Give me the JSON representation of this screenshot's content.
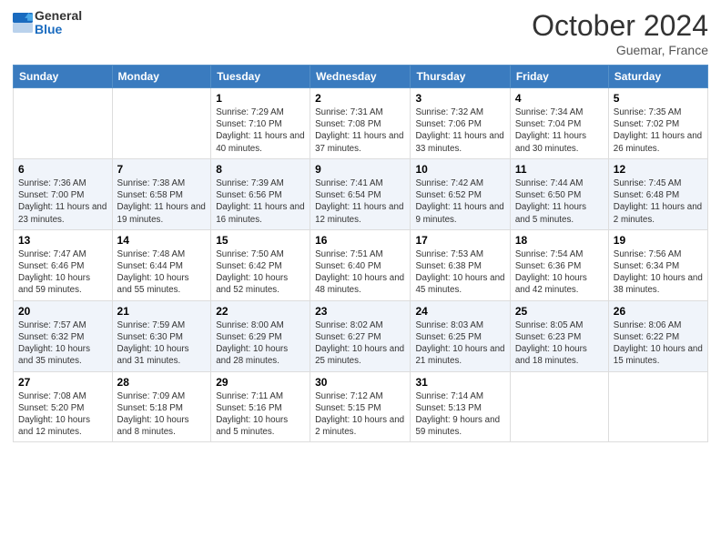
{
  "header": {
    "logo_general": "General",
    "logo_blue": "Blue",
    "month_title": "October 2024",
    "location": "Guemar, France"
  },
  "weekdays": [
    "Sunday",
    "Monday",
    "Tuesday",
    "Wednesday",
    "Thursday",
    "Friday",
    "Saturday"
  ],
  "weeks": [
    [
      {
        "day": "",
        "info": ""
      },
      {
        "day": "",
        "info": ""
      },
      {
        "day": "1",
        "info": "Sunrise: 7:29 AM\nSunset: 7:10 PM\nDaylight: 11 hours and 40 minutes."
      },
      {
        "day": "2",
        "info": "Sunrise: 7:31 AM\nSunset: 7:08 PM\nDaylight: 11 hours and 37 minutes."
      },
      {
        "day": "3",
        "info": "Sunrise: 7:32 AM\nSunset: 7:06 PM\nDaylight: 11 hours and 33 minutes."
      },
      {
        "day": "4",
        "info": "Sunrise: 7:34 AM\nSunset: 7:04 PM\nDaylight: 11 hours and 30 minutes."
      },
      {
        "day": "5",
        "info": "Sunrise: 7:35 AM\nSunset: 7:02 PM\nDaylight: 11 hours and 26 minutes."
      }
    ],
    [
      {
        "day": "6",
        "info": "Sunrise: 7:36 AM\nSunset: 7:00 PM\nDaylight: 11 hours and 23 minutes."
      },
      {
        "day": "7",
        "info": "Sunrise: 7:38 AM\nSunset: 6:58 PM\nDaylight: 11 hours and 19 minutes."
      },
      {
        "day": "8",
        "info": "Sunrise: 7:39 AM\nSunset: 6:56 PM\nDaylight: 11 hours and 16 minutes."
      },
      {
        "day": "9",
        "info": "Sunrise: 7:41 AM\nSunset: 6:54 PM\nDaylight: 11 hours and 12 minutes."
      },
      {
        "day": "10",
        "info": "Sunrise: 7:42 AM\nSunset: 6:52 PM\nDaylight: 11 hours and 9 minutes."
      },
      {
        "day": "11",
        "info": "Sunrise: 7:44 AM\nSunset: 6:50 PM\nDaylight: 11 hours and 5 minutes."
      },
      {
        "day": "12",
        "info": "Sunrise: 7:45 AM\nSunset: 6:48 PM\nDaylight: 11 hours and 2 minutes."
      }
    ],
    [
      {
        "day": "13",
        "info": "Sunrise: 7:47 AM\nSunset: 6:46 PM\nDaylight: 10 hours and 59 minutes."
      },
      {
        "day": "14",
        "info": "Sunrise: 7:48 AM\nSunset: 6:44 PM\nDaylight: 10 hours and 55 minutes."
      },
      {
        "day": "15",
        "info": "Sunrise: 7:50 AM\nSunset: 6:42 PM\nDaylight: 10 hours and 52 minutes."
      },
      {
        "day": "16",
        "info": "Sunrise: 7:51 AM\nSunset: 6:40 PM\nDaylight: 10 hours and 48 minutes."
      },
      {
        "day": "17",
        "info": "Sunrise: 7:53 AM\nSunset: 6:38 PM\nDaylight: 10 hours and 45 minutes."
      },
      {
        "day": "18",
        "info": "Sunrise: 7:54 AM\nSunset: 6:36 PM\nDaylight: 10 hours and 42 minutes."
      },
      {
        "day": "19",
        "info": "Sunrise: 7:56 AM\nSunset: 6:34 PM\nDaylight: 10 hours and 38 minutes."
      }
    ],
    [
      {
        "day": "20",
        "info": "Sunrise: 7:57 AM\nSunset: 6:32 PM\nDaylight: 10 hours and 35 minutes."
      },
      {
        "day": "21",
        "info": "Sunrise: 7:59 AM\nSunset: 6:30 PM\nDaylight: 10 hours and 31 minutes."
      },
      {
        "day": "22",
        "info": "Sunrise: 8:00 AM\nSunset: 6:29 PM\nDaylight: 10 hours and 28 minutes."
      },
      {
        "day": "23",
        "info": "Sunrise: 8:02 AM\nSunset: 6:27 PM\nDaylight: 10 hours and 25 minutes."
      },
      {
        "day": "24",
        "info": "Sunrise: 8:03 AM\nSunset: 6:25 PM\nDaylight: 10 hours and 21 minutes."
      },
      {
        "day": "25",
        "info": "Sunrise: 8:05 AM\nSunset: 6:23 PM\nDaylight: 10 hours and 18 minutes."
      },
      {
        "day": "26",
        "info": "Sunrise: 8:06 AM\nSunset: 6:22 PM\nDaylight: 10 hours and 15 minutes."
      }
    ],
    [
      {
        "day": "27",
        "info": "Sunrise: 7:08 AM\nSunset: 5:20 PM\nDaylight: 10 hours and 12 minutes."
      },
      {
        "day": "28",
        "info": "Sunrise: 7:09 AM\nSunset: 5:18 PM\nDaylight: 10 hours and 8 minutes."
      },
      {
        "day": "29",
        "info": "Sunrise: 7:11 AM\nSunset: 5:16 PM\nDaylight: 10 hours and 5 minutes."
      },
      {
        "day": "30",
        "info": "Sunrise: 7:12 AM\nSunset: 5:15 PM\nDaylight: 10 hours and 2 minutes."
      },
      {
        "day": "31",
        "info": "Sunrise: 7:14 AM\nSunset: 5:13 PM\nDaylight: 9 hours and 59 minutes."
      },
      {
        "day": "",
        "info": ""
      },
      {
        "day": "",
        "info": ""
      }
    ]
  ]
}
